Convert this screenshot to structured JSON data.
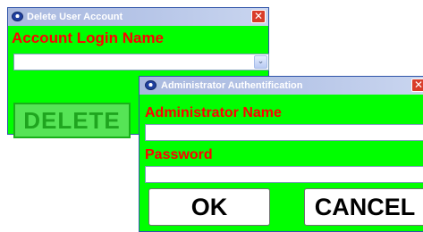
{
  "delete_window": {
    "title": "Delete User Account",
    "close_label": "✕",
    "account_label": "Account Login Name",
    "account_value": "",
    "dropdown_arrow": "⌄",
    "delete_label": "DELETE",
    "icon": "app-logo-icon"
  },
  "auth_window": {
    "title": "Administrator Authentification",
    "close_label": "✕",
    "admin_name_label": "Administrator Name",
    "admin_name_value": "",
    "password_label": "Password",
    "password_value": "",
    "ok_label": "OK",
    "cancel_label": "CANCEL",
    "icon": "app-logo-icon"
  },
  "colors": {
    "window_bg": "#00ff00",
    "label_red": "#ff0000",
    "titlebar": "#b7c6e8",
    "close_red": "#d93d2a",
    "disabled_button": "#55e055"
  }
}
